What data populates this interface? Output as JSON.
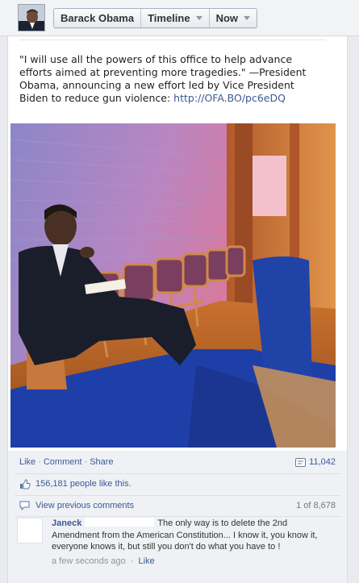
{
  "header": {
    "profile_name": "Barack Obama",
    "timeline_label": "Timeline",
    "now_label": "Now"
  },
  "post": {
    "text": "\"I will use all the powers of this office to help advance efforts aimed at preventing more tragedies.\" —President Obama, announcing a new effort led by Vice President Biden to reduce gun violence: ",
    "link": "http://OFA.BO/pc6eDQ"
  },
  "actions": {
    "like": "Like",
    "comment": "Comment",
    "share": "Share",
    "share_count": "11,042"
  },
  "likes": {
    "text": "156,181 people like this."
  },
  "comments": {
    "view_previous": "View previous comments",
    "count": "1 of 8,678",
    "items": [
      {
        "author": "Janeck",
        "text": "The only way is to delete the 2nd Amendment from the American Constitution... I know it, you know it, everyone knows it, but still you don't do what you have to !",
        "time": "a few seconds ago",
        "like": "Like"
      }
    ]
  },
  "colors": {
    "link_blue": "#3b5998",
    "bar_bg": "#eff1f5"
  }
}
